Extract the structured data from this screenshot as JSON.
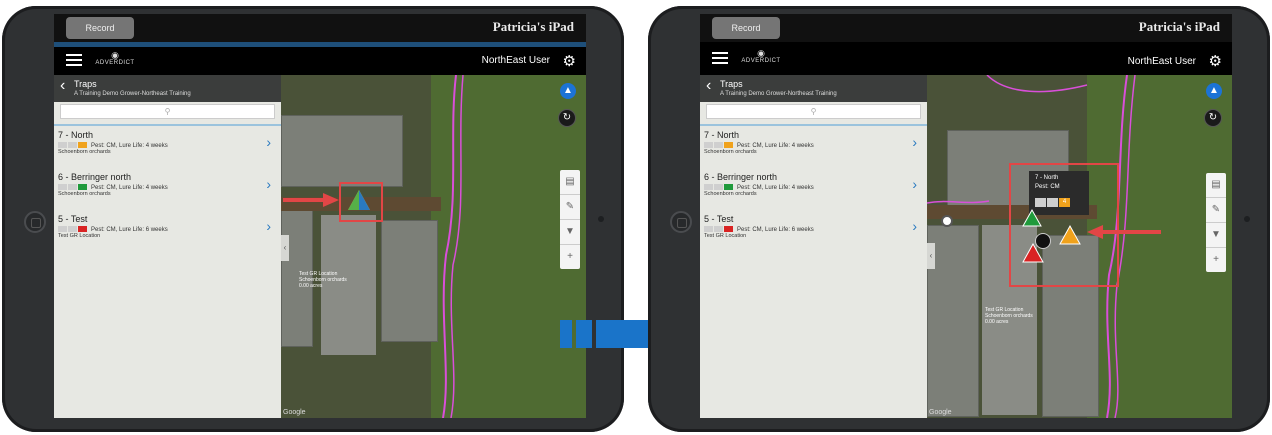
{
  "left": {
    "record_label": "Record",
    "device_name": "Patricia's iPad",
    "brand": "ADVERDICT",
    "user": "NorthEast User",
    "panel": {
      "title": "Traps",
      "subtitle": "A Training Demo Grower-Northeast Training",
      "items": [
        {
          "name": "7 - North",
          "badge": "4",
          "info": "Pest: CM, Lure Life: 4 weeks",
          "location": "Schoenborn orchards"
        },
        {
          "name": "6 - Berringer north",
          "badge": "0",
          "info": "Pest: CM, Lure Life: 4 weeks",
          "location": "Schoenborn orchards"
        },
        {
          "name": "5 - Test",
          "badge": "40/5",
          "info": "Pest: CM, Lure Life: 6 weeks",
          "location": "Test GR Location"
        }
      ]
    },
    "map_label": "Test GR Location\nSchoenborn orchards\n0.00 acres",
    "google": "Google"
  },
  "right": {
    "record_label": "Record",
    "device_name": "Patricia's iPad",
    "brand": "ADVERDICT",
    "user": "NorthEast User",
    "panel": {
      "title": "Traps",
      "subtitle": "A Training Demo Grower-Northeast Training",
      "items": [
        {
          "name": "7 - North",
          "badge": "4",
          "info": "Pest: CM, Lure Life: 4 weeks",
          "location": "Schoenborn orchards"
        },
        {
          "name": "6 - Berringer north",
          "badge": "0",
          "info": "Pest: CM, Lure Life: 4 weeks",
          "location": "Schoenborn orchards"
        },
        {
          "name": "5 - Test",
          "badge": "40/5",
          "info": "Pest: CM, Lure Life: 6 weeks",
          "location": "Test GR Location"
        }
      ]
    },
    "popup": {
      "title": "7 - North",
      "pest": "Pest: CM",
      "badge": "4"
    },
    "map_label": "Test GR Location\nSchoenborn orchards\n0.00 acres",
    "google": "Google"
  },
  "colors": {
    "accent_blue": "#1c73d6",
    "arrow_blue": "#1a74c9",
    "highlight_red": "#e24646",
    "badge_orange": "#f0a21c",
    "badge_green": "#1f9a3b",
    "badge_red": "#d92323"
  },
  "icons": {
    "menu": "hamburger-icon",
    "settings": "gear-icon",
    "back": "chevron-left-icon",
    "search": "search-icon",
    "forward": "chevron-right-icon",
    "chart": "bar-chart-icon",
    "edit": "edit-icon",
    "filter": "filter-icon",
    "add": "plus-icon",
    "location": "navigation-icon",
    "refresh": "refresh-icon"
  }
}
